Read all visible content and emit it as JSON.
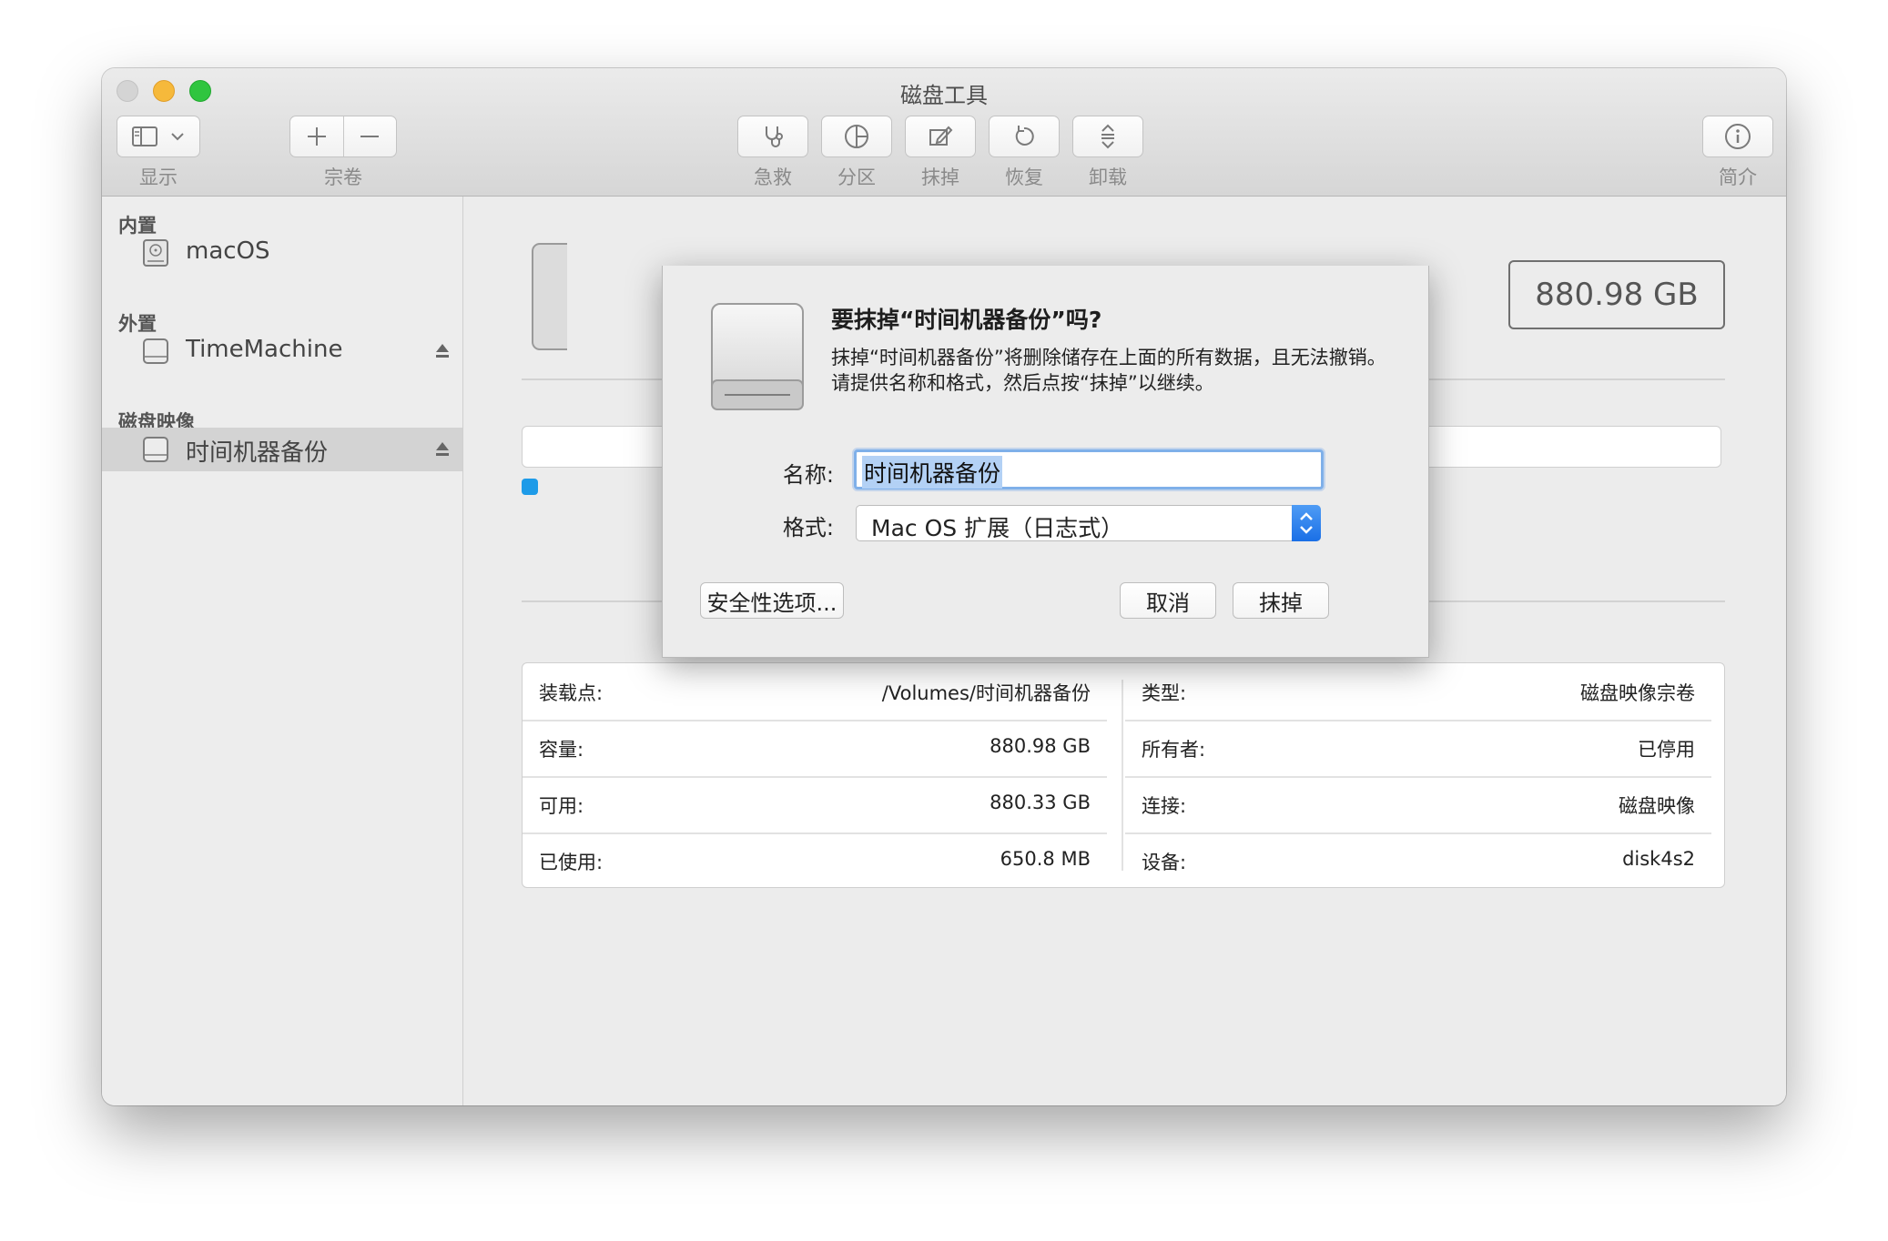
{
  "window": {
    "title": "磁盘工具"
  },
  "toolbar": {
    "view_label": "显示",
    "volume_label": "宗卷",
    "firstaid_label": "急救",
    "partition_label": "分区",
    "erase_label": "抹掉",
    "restore_label": "恢复",
    "unmount_label": "卸载",
    "info_label": "简介"
  },
  "sidebar": {
    "internal_header": "内置",
    "external_header": "外置",
    "images_header": "磁盘映像",
    "items": [
      {
        "label": "macOS"
      },
      {
        "label": "TimeMachine"
      },
      {
        "label": "时间机器备份"
      }
    ]
  },
  "main": {
    "capacity_box": "880.98 GB",
    "info": {
      "left": [
        {
          "key": "装载点:",
          "value": "/Volumes/时间机器备份"
        },
        {
          "key": "容量:",
          "value": "880.98 GB"
        },
        {
          "key": "可用:",
          "value": "880.33 GB"
        },
        {
          "key": "已使用:",
          "value": "650.8 MB"
        }
      ],
      "right": [
        {
          "key": "类型:",
          "value": "磁盘映像宗卷"
        },
        {
          "key": "所有者:",
          "value": "已停用"
        },
        {
          "key": "连接:",
          "value": "磁盘映像"
        },
        {
          "key": "设备:",
          "value": "disk4s2"
        }
      ]
    }
  },
  "dialog": {
    "title": "要抹掉“时间机器备份”吗?",
    "message": "抹掉“时间机器备份”将删除储存在上面的所有数据，且无法撤销。请提供名称和格式，然后点按“抹掉”以继续。",
    "name_label": "名称:",
    "name_value": "时间机器备份",
    "format_label": "格式:",
    "format_value": "Mac OS 扩展（日志式）",
    "security_button": "安全性选项...",
    "cancel_button": "取消",
    "erase_button": "抹掉"
  },
  "colors": {
    "accent": "#1a6fe6",
    "selection": "#b3d1f5",
    "legend_blue": "#1e9be8"
  }
}
